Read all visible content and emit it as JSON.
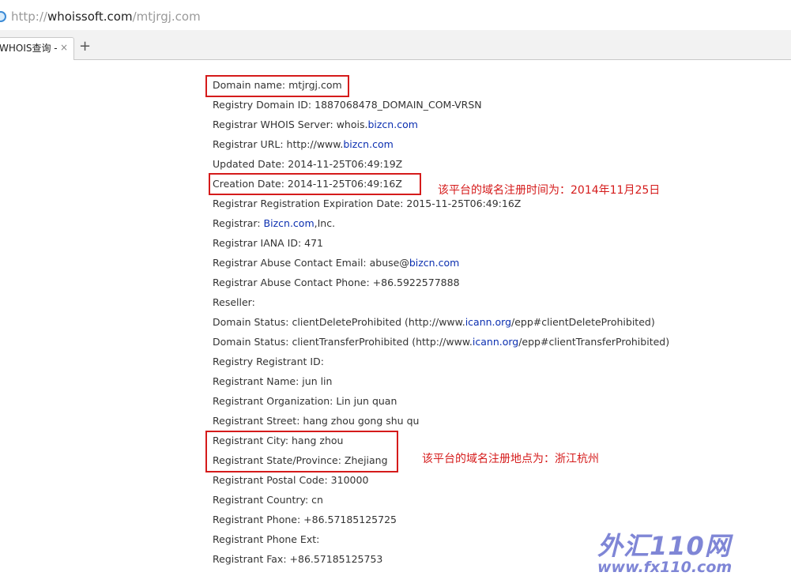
{
  "browser": {
    "url_prefix": "http://",
    "url_host": "whoissoft.com",
    "url_path": "/mtjrgj.com",
    "tab_title": "WHOIS查询 -",
    "tab_close": "×",
    "new_tab": "+"
  },
  "whois": {
    "rows": [
      {
        "parts": [
          {
            "text": "Domain name: mtjrgj.com"
          }
        ]
      },
      {
        "parts": [
          {
            "text": "Registry Domain ID: 1887068478_DOMAIN_COM-VRSN"
          }
        ]
      },
      {
        "parts": [
          {
            "text": "Registrar WHOIS Server: whois."
          },
          {
            "text": "bizcn.com",
            "link": true
          }
        ]
      },
      {
        "parts": [
          {
            "text": "Registrar URL: http://www."
          },
          {
            "text": "bizcn.com",
            "link": true
          }
        ]
      },
      {
        "parts": [
          {
            "text": "Updated Date: 2014-11-25T06:49:19Z"
          }
        ]
      },
      {
        "parts": [
          {
            "text": "Creation Date: 2014-11-25T06:49:16Z"
          }
        ]
      },
      {
        "parts": [
          {
            "text": "Registrar Registration Expiration Date: 2015-11-25T06:49:16Z"
          }
        ]
      },
      {
        "parts": [
          {
            "text": "Registrar: "
          },
          {
            "text": "Bizcn.com",
            "link": true
          },
          {
            "text": ",Inc."
          }
        ]
      },
      {
        "parts": [
          {
            "text": "Registrar IANA ID: 471"
          }
        ]
      },
      {
        "parts": [
          {
            "text": "Registrar Abuse Contact Email: abuse@"
          },
          {
            "text": "bizcn.com",
            "link": true
          }
        ]
      },
      {
        "parts": [
          {
            "text": "Registrar Abuse Contact Phone: +86.5922577888"
          }
        ]
      },
      {
        "parts": [
          {
            "text": "Reseller:"
          }
        ]
      },
      {
        "parts": [
          {
            "text": "Domain Status: clientDeleteProhibited (http://www."
          },
          {
            "text": "icann.org",
            "link": true
          },
          {
            "text": "/epp#clientDeleteProhibited)"
          }
        ]
      },
      {
        "parts": [
          {
            "text": "Domain Status: clientTransferProhibited (http://www."
          },
          {
            "text": "icann.org",
            "link": true
          },
          {
            "text": "/epp#clientTransferProhibited)"
          }
        ]
      },
      {
        "parts": [
          {
            "text": "Registry Registrant ID:"
          }
        ]
      },
      {
        "parts": [
          {
            "text": "Registrant Name: jun lin"
          }
        ]
      },
      {
        "parts": [
          {
            "text": "Registrant Organization: Lin jun quan"
          }
        ]
      },
      {
        "parts": [
          {
            "text": "Registrant Street: hang zhou gong shu qu"
          }
        ]
      },
      {
        "parts": [
          {
            "text": "Registrant City: hang zhou"
          }
        ]
      },
      {
        "parts": [
          {
            "text": "Registrant State/Province: Zhejiang"
          }
        ]
      },
      {
        "parts": [
          {
            "text": "Registrant Postal Code: 310000"
          }
        ]
      },
      {
        "parts": [
          {
            "text": "Registrant Country: cn"
          }
        ]
      },
      {
        "parts": [
          {
            "text": "Registrant Phone: +86.57185125725"
          }
        ]
      },
      {
        "parts": [
          {
            "text": "Registrant Phone Ext:"
          }
        ]
      },
      {
        "parts": [
          {
            "text": "Registrant Fax: +86.57185125753"
          }
        ]
      }
    ]
  },
  "annotations": {
    "creation_note": "该平台的域名注册时间为：2014年11月25日",
    "location_note": "该平台的域名注册地点为：浙江杭州"
  },
  "watermark": {
    "logo": "外汇110网",
    "site": "www.fx110.com"
  },
  "colors": {
    "highlight": "#d51b1b",
    "link": "#0b2fb0",
    "watermark": "#7f86d6"
  }
}
